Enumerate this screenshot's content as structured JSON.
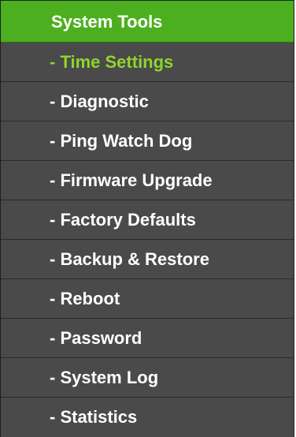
{
  "menu": {
    "header": "System Tools",
    "items": [
      {
        "label": "- Time Settings",
        "active": true
      },
      {
        "label": "- Diagnostic",
        "active": false
      },
      {
        "label": "- Ping Watch Dog",
        "active": false
      },
      {
        "label": "- Firmware Upgrade",
        "active": false
      },
      {
        "label": "- Factory Defaults",
        "active": false
      },
      {
        "label": "- Backup & Restore",
        "active": false
      },
      {
        "label": "- Reboot",
        "active": false
      },
      {
        "label": "- Password",
        "active": false
      },
      {
        "label": "- System Log",
        "active": false
      },
      {
        "label": "- Statistics",
        "active": false
      }
    ]
  },
  "colors": {
    "header_bg": "#4caf1f",
    "item_bg": "#4a4a4a",
    "active_text": "#8fd42e",
    "text": "#ffffff"
  }
}
